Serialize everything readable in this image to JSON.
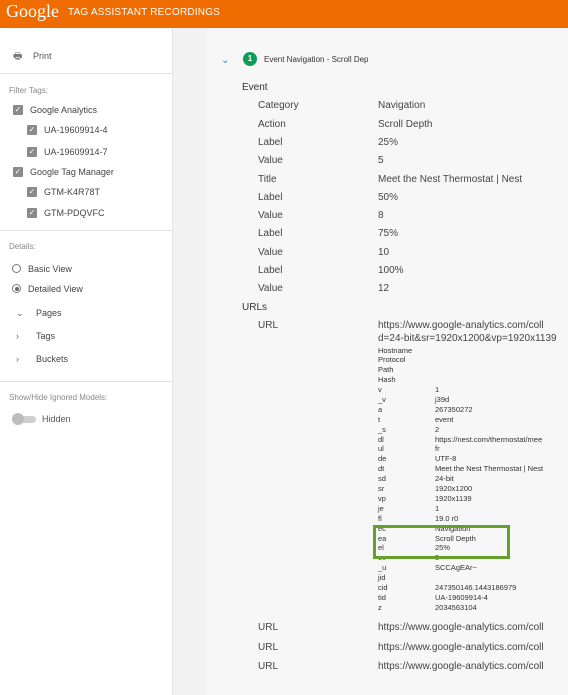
{
  "header": {
    "logo": "Google",
    "app_name": "TAG ASSISTANT RECORDINGS"
  },
  "sidebar": {
    "print_label": "Print",
    "filter_tags_label": "Filter Tags:",
    "filters": [
      {
        "label": "Google Analytics",
        "checked": true
      },
      {
        "label": "UA-19609914-4",
        "checked": true
      },
      {
        "label": "UA-19609914-7",
        "checked": true
      },
      {
        "label": "Google Tag Manager",
        "checked": true
      },
      {
        "label": "GTM-K4R78T",
        "checked": true
      },
      {
        "label": "GTM-PDQVFC",
        "checked": true
      }
    ],
    "details_label": "Details:",
    "views": [
      {
        "label": "Basic View",
        "selected": false
      },
      {
        "label": "Detailed View",
        "selected": true
      }
    ],
    "groups": [
      {
        "label": "Pages",
        "expanded": true
      },
      {
        "label": "Tags",
        "expanded": false
      },
      {
        "label": "Buckets",
        "expanded": false
      }
    ],
    "show_hide_label": "Show/Hide Ignored Models:",
    "hidden_toggle_label": "Hidden"
  },
  "event": {
    "number": "1",
    "title": "Event Navigation - Scroll Dep",
    "section_event": "Event",
    "fields": [
      {
        "key": "Category",
        "value": "Navigation"
      },
      {
        "key": "Action",
        "value": "Scroll Depth"
      },
      {
        "key": "Label",
        "value": "25%"
      },
      {
        "key": "Value",
        "value": "5"
      },
      {
        "key": "Title",
        "value": "Meet the Nest Thermostat | Nest"
      },
      {
        "key": "Label",
        "value": "50%"
      },
      {
        "key": "Value",
        "value": "8"
      },
      {
        "key": "Label",
        "value": "75%"
      },
      {
        "key": "Value",
        "value": "10"
      },
      {
        "key": "Label",
        "value": "100%"
      },
      {
        "key": "Value",
        "value": "12"
      }
    ],
    "section_urls": "URLs",
    "url_label": "URL",
    "url_line1": "https://www.google-analytics.com/coll",
    "url_line2": "d=24-bit&sr=1920x1200&vp=1920x1139",
    "url_headings": [
      "Hostname",
      "Protocol",
      "Path",
      "Hash"
    ],
    "params": [
      {
        "k": "v",
        "v": "1"
      },
      {
        "k": "_v",
        "v": "j39d"
      },
      {
        "k": "a",
        "v": "267350272"
      },
      {
        "k": "t",
        "v": "event"
      },
      {
        "k": "_s",
        "v": "2"
      },
      {
        "k": "dl",
        "v": "https://nest.com/thermostat/mee"
      },
      {
        "k": "ul",
        "v": "fr"
      },
      {
        "k": "de",
        "v": "UTF-8"
      },
      {
        "k": "dt",
        "v": "Meet the Nest Thermostat | Nest"
      },
      {
        "k": "sd",
        "v": "24-bit"
      },
      {
        "k": "sr",
        "v": "1920x1200"
      },
      {
        "k": "vp",
        "v": "1920x1139"
      },
      {
        "k": "je",
        "v": "1"
      },
      {
        "k": "fl",
        "v": "19.0 r0"
      },
      {
        "k": "ec",
        "v": "Navigation"
      },
      {
        "k": "ea",
        "v": "Scroll Depth"
      },
      {
        "k": "el",
        "v": "25%"
      },
      {
        "k": "ev",
        "v": "5"
      },
      {
        "k": "_u",
        "v": "SCCAgEAr~"
      },
      {
        "k": "jid",
        "v": ""
      },
      {
        "k": "cid",
        "v": "247350146.1443186979"
      },
      {
        "k": "tid",
        "v": "UA-19609914-4"
      },
      {
        "k": "z",
        "v": "2034563104"
      }
    ],
    "more_urls": [
      {
        "key": "URL",
        "value": "https://www.google-analytics.com/coll"
      },
      {
        "key": "URL",
        "value": "https://www.google-analytics.com/coll"
      },
      {
        "key": "URL",
        "value": "https://www.google-analytics.com/coll"
      }
    ]
  },
  "colors": {
    "topbar": "#ef6c00",
    "badge": "#0f9d58",
    "highlight": "#64a02c"
  }
}
